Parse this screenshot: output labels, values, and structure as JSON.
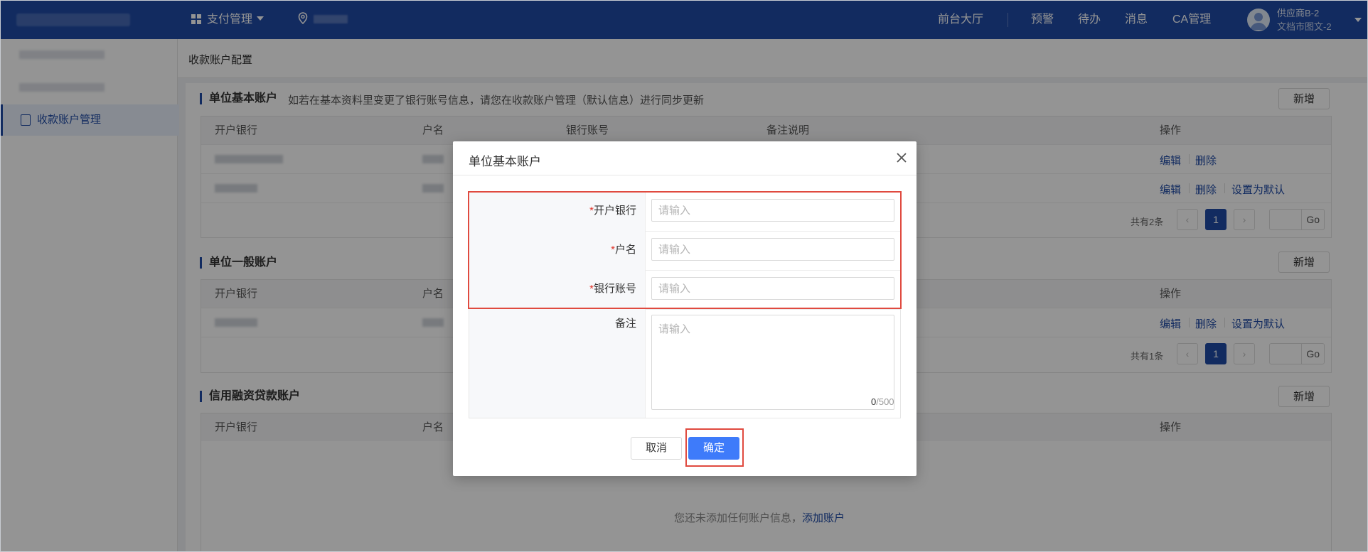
{
  "topbar": {
    "nav_payment": "支付管理",
    "links": [
      "前台大厅",
      "预警",
      "待办",
      "消息",
      "CA管理"
    ],
    "user_name": "供应商B-2",
    "user_org": "文档市图文-2"
  },
  "sidebar": {
    "active_item": "收款账户管理"
  },
  "breadcrumb": "收款账户配置",
  "sections": {
    "basic": {
      "title": "单位基本账户",
      "note": "如若在基本资料里变更了银行账号信息，请您在收款账户管理（默认信息）进行同步更新",
      "new_label": "新增"
    },
    "general": {
      "title": "单位一般账户",
      "new_label": "新增"
    },
    "credit": {
      "title": "信用融资贷款账户",
      "new_label": "新增"
    }
  },
  "table": {
    "headers": [
      "开户银行",
      "户名",
      "银行账号",
      "备注说明",
      "操作"
    ],
    "ops": {
      "edit": "编辑",
      "delete": "删除",
      "set_default": "设置为默认"
    }
  },
  "pager": {
    "basic_total": "共有2条",
    "general_total": "共有1条",
    "page": "1",
    "go": "Go"
  },
  "empty": {
    "text": "您还未添加任何账户信息，",
    "link": "添加账户"
  },
  "modal": {
    "title": "单位基本账户",
    "fields": [
      {
        "label": "开户银行",
        "required": "*",
        "placeholder": "请输入"
      },
      {
        "label": "户名",
        "required": "*",
        "placeholder": "请输入"
      },
      {
        "label": "银行账号",
        "required": "*",
        "placeholder": "请输入"
      },
      {
        "label": "备注",
        "placeholder": "请输入"
      }
    ],
    "counter_current": "0",
    "counter_max": "/500",
    "cancel": "取消",
    "confirm": "确定"
  },
  "colors": {
    "nav_bg": "#1f4aa6",
    "primary_button": "#3e7bfa",
    "highlight": "#e04a3f",
    "required": "#e0352b"
  }
}
